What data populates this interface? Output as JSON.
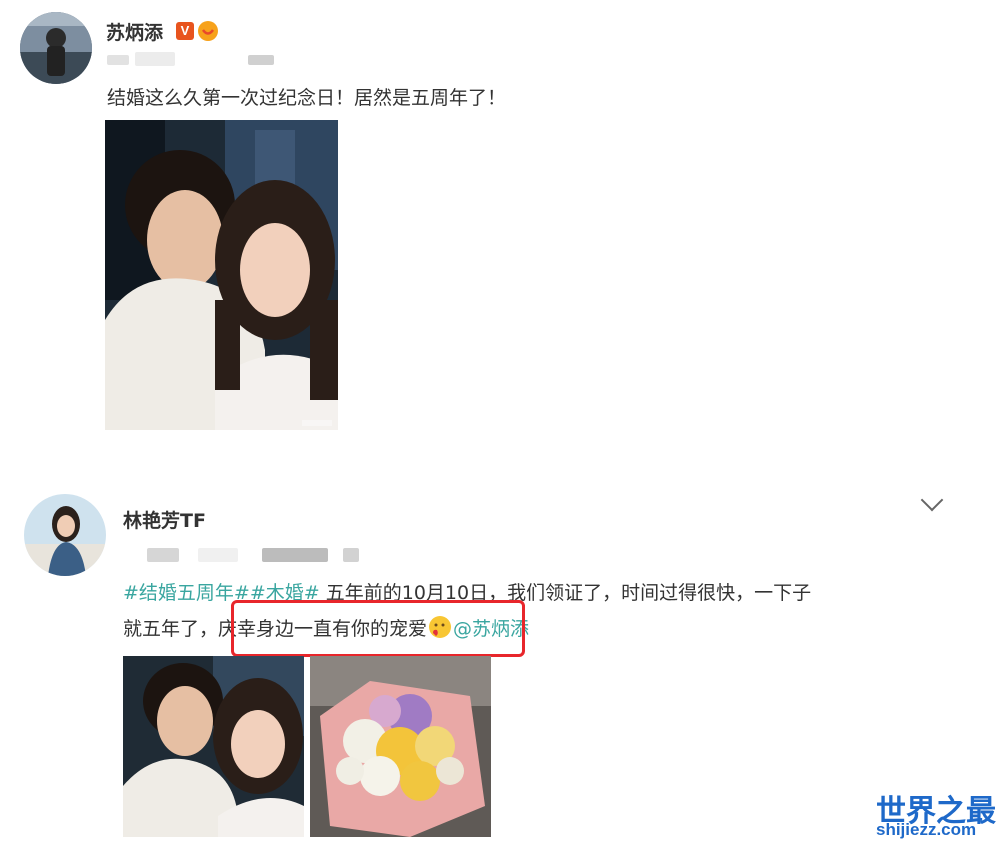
{
  "post1": {
    "author": "苏炳添",
    "badge_v": "V",
    "text": "结婚这么久第一次过纪念日！居然是五周年了！"
  },
  "post2": {
    "author": "林艳芳TF",
    "tag1": "#结婚五周年#",
    "tag2": "#木婚#",
    "line1_rest": " 五年前的10月10日，我们领证了，时间过得很快，一下子",
    "line2_pre": "就五年了，",
    "line2_highlight": "庆幸身边一直有你的宠爱",
    "mention": "@苏炳添"
  },
  "watermark": {
    "line1": "世界之最",
    "line2": "shijiezz.com"
  },
  "colors": {
    "link": "#3aa6a0",
    "highlight_border": "#e8262b",
    "watermark": "#1e69c9",
    "badge_v": "#e8541e"
  }
}
